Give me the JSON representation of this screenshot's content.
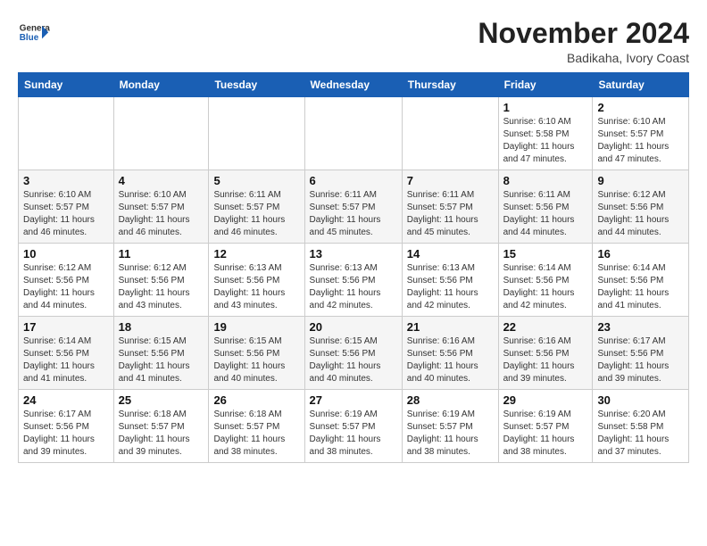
{
  "header": {
    "logo_general": "General",
    "logo_blue": "Blue",
    "month_title": "November 2024",
    "subtitle": "Badikaha, Ivory Coast"
  },
  "weekdays": [
    "Sunday",
    "Monday",
    "Tuesday",
    "Wednesday",
    "Thursday",
    "Friday",
    "Saturday"
  ],
  "weeks": [
    [
      {
        "day": "",
        "info": ""
      },
      {
        "day": "",
        "info": ""
      },
      {
        "day": "",
        "info": ""
      },
      {
        "day": "",
        "info": ""
      },
      {
        "day": "",
        "info": ""
      },
      {
        "day": "1",
        "info": "Sunrise: 6:10 AM\nSunset: 5:58 PM\nDaylight: 11 hours and 47 minutes."
      },
      {
        "day": "2",
        "info": "Sunrise: 6:10 AM\nSunset: 5:57 PM\nDaylight: 11 hours and 47 minutes."
      }
    ],
    [
      {
        "day": "3",
        "info": "Sunrise: 6:10 AM\nSunset: 5:57 PM\nDaylight: 11 hours and 46 minutes."
      },
      {
        "day": "4",
        "info": "Sunrise: 6:10 AM\nSunset: 5:57 PM\nDaylight: 11 hours and 46 minutes."
      },
      {
        "day": "5",
        "info": "Sunrise: 6:11 AM\nSunset: 5:57 PM\nDaylight: 11 hours and 46 minutes."
      },
      {
        "day": "6",
        "info": "Sunrise: 6:11 AM\nSunset: 5:57 PM\nDaylight: 11 hours and 45 minutes."
      },
      {
        "day": "7",
        "info": "Sunrise: 6:11 AM\nSunset: 5:57 PM\nDaylight: 11 hours and 45 minutes."
      },
      {
        "day": "8",
        "info": "Sunrise: 6:11 AM\nSunset: 5:56 PM\nDaylight: 11 hours and 44 minutes."
      },
      {
        "day": "9",
        "info": "Sunrise: 6:12 AM\nSunset: 5:56 PM\nDaylight: 11 hours and 44 minutes."
      }
    ],
    [
      {
        "day": "10",
        "info": "Sunrise: 6:12 AM\nSunset: 5:56 PM\nDaylight: 11 hours and 44 minutes."
      },
      {
        "day": "11",
        "info": "Sunrise: 6:12 AM\nSunset: 5:56 PM\nDaylight: 11 hours and 43 minutes."
      },
      {
        "day": "12",
        "info": "Sunrise: 6:13 AM\nSunset: 5:56 PM\nDaylight: 11 hours and 43 minutes."
      },
      {
        "day": "13",
        "info": "Sunrise: 6:13 AM\nSunset: 5:56 PM\nDaylight: 11 hours and 42 minutes."
      },
      {
        "day": "14",
        "info": "Sunrise: 6:13 AM\nSunset: 5:56 PM\nDaylight: 11 hours and 42 minutes."
      },
      {
        "day": "15",
        "info": "Sunrise: 6:14 AM\nSunset: 5:56 PM\nDaylight: 11 hours and 42 minutes."
      },
      {
        "day": "16",
        "info": "Sunrise: 6:14 AM\nSunset: 5:56 PM\nDaylight: 11 hours and 41 minutes."
      }
    ],
    [
      {
        "day": "17",
        "info": "Sunrise: 6:14 AM\nSunset: 5:56 PM\nDaylight: 11 hours and 41 minutes."
      },
      {
        "day": "18",
        "info": "Sunrise: 6:15 AM\nSunset: 5:56 PM\nDaylight: 11 hours and 41 minutes."
      },
      {
        "day": "19",
        "info": "Sunrise: 6:15 AM\nSunset: 5:56 PM\nDaylight: 11 hours and 40 minutes."
      },
      {
        "day": "20",
        "info": "Sunrise: 6:15 AM\nSunset: 5:56 PM\nDaylight: 11 hours and 40 minutes."
      },
      {
        "day": "21",
        "info": "Sunrise: 6:16 AM\nSunset: 5:56 PM\nDaylight: 11 hours and 40 minutes."
      },
      {
        "day": "22",
        "info": "Sunrise: 6:16 AM\nSunset: 5:56 PM\nDaylight: 11 hours and 39 minutes."
      },
      {
        "day": "23",
        "info": "Sunrise: 6:17 AM\nSunset: 5:56 PM\nDaylight: 11 hours and 39 minutes."
      }
    ],
    [
      {
        "day": "24",
        "info": "Sunrise: 6:17 AM\nSunset: 5:56 PM\nDaylight: 11 hours and 39 minutes."
      },
      {
        "day": "25",
        "info": "Sunrise: 6:18 AM\nSunset: 5:57 PM\nDaylight: 11 hours and 39 minutes."
      },
      {
        "day": "26",
        "info": "Sunrise: 6:18 AM\nSunset: 5:57 PM\nDaylight: 11 hours and 38 minutes."
      },
      {
        "day": "27",
        "info": "Sunrise: 6:19 AM\nSunset: 5:57 PM\nDaylight: 11 hours and 38 minutes."
      },
      {
        "day": "28",
        "info": "Sunrise: 6:19 AM\nSunset: 5:57 PM\nDaylight: 11 hours and 38 minutes."
      },
      {
        "day": "29",
        "info": "Sunrise: 6:19 AM\nSunset: 5:57 PM\nDaylight: 11 hours and 38 minutes."
      },
      {
        "day": "30",
        "info": "Sunrise: 6:20 AM\nSunset: 5:58 PM\nDaylight: 11 hours and 37 minutes."
      }
    ]
  ]
}
